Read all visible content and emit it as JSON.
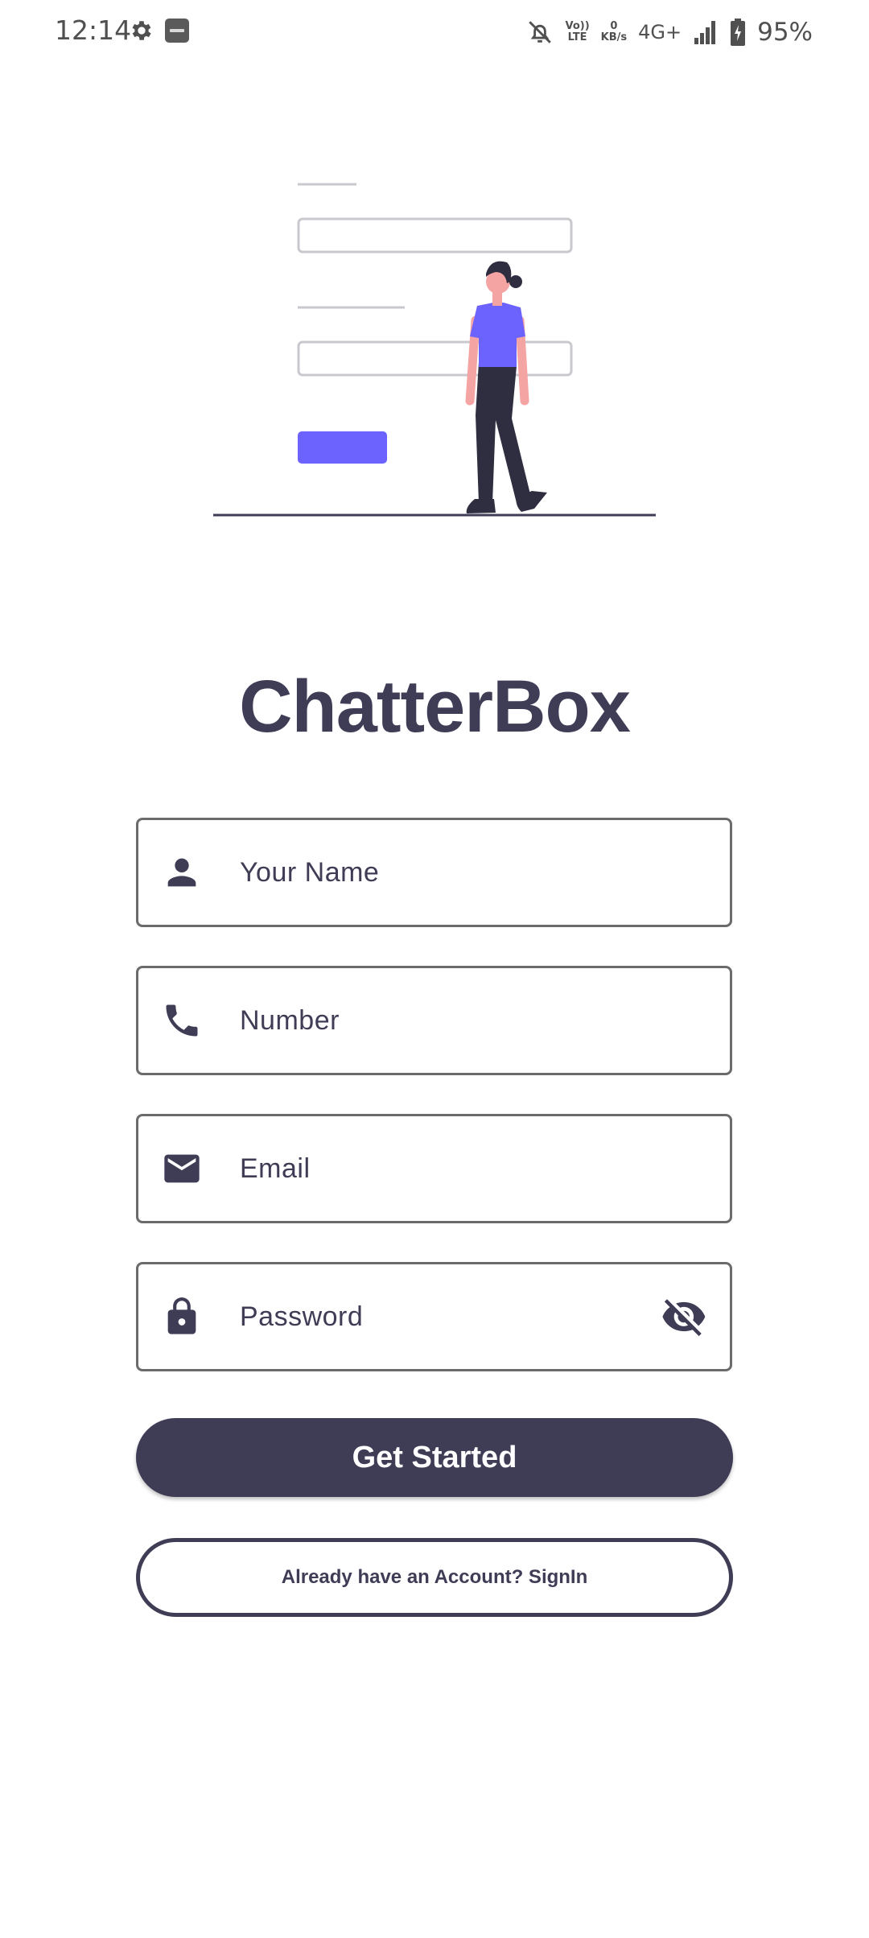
{
  "status_bar": {
    "time": "12:14",
    "volte_top": "Vo))",
    "volte_bottom": "LTE",
    "speed_value": "0",
    "speed_unit": "KB/s",
    "network": "4G+",
    "battery": "95%",
    "icons": [
      "gear-icon",
      "paytm-app-icon",
      "bell-off-icon",
      "signal-icon",
      "battery-charging-icon"
    ]
  },
  "app": {
    "title": "ChatterBox"
  },
  "form": {
    "name": {
      "placeholder": "Your Name",
      "value": "",
      "icon": "person-icon"
    },
    "number": {
      "placeholder": "Number",
      "value": "",
      "icon": "phone-icon"
    },
    "email": {
      "placeholder": "Email",
      "value": "",
      "icon": "mail-icon"
    },
    "password": {
      "placeholder": "Password",
      "value": "",
      "icon": "lock-icon",
      "toggle_icon": "eye-off-icon"
    }
  },
  "actions": {
    "primary_label": "Get Started",
    "secondary_label": "Already have an Account? SignIn"
  },
  "colors": {
    "primary": "#3f3d56",
    "accent": "#6c63ff",
    "skin": "#f5a4a4",
    "background": "#ffffff"
  }
}
